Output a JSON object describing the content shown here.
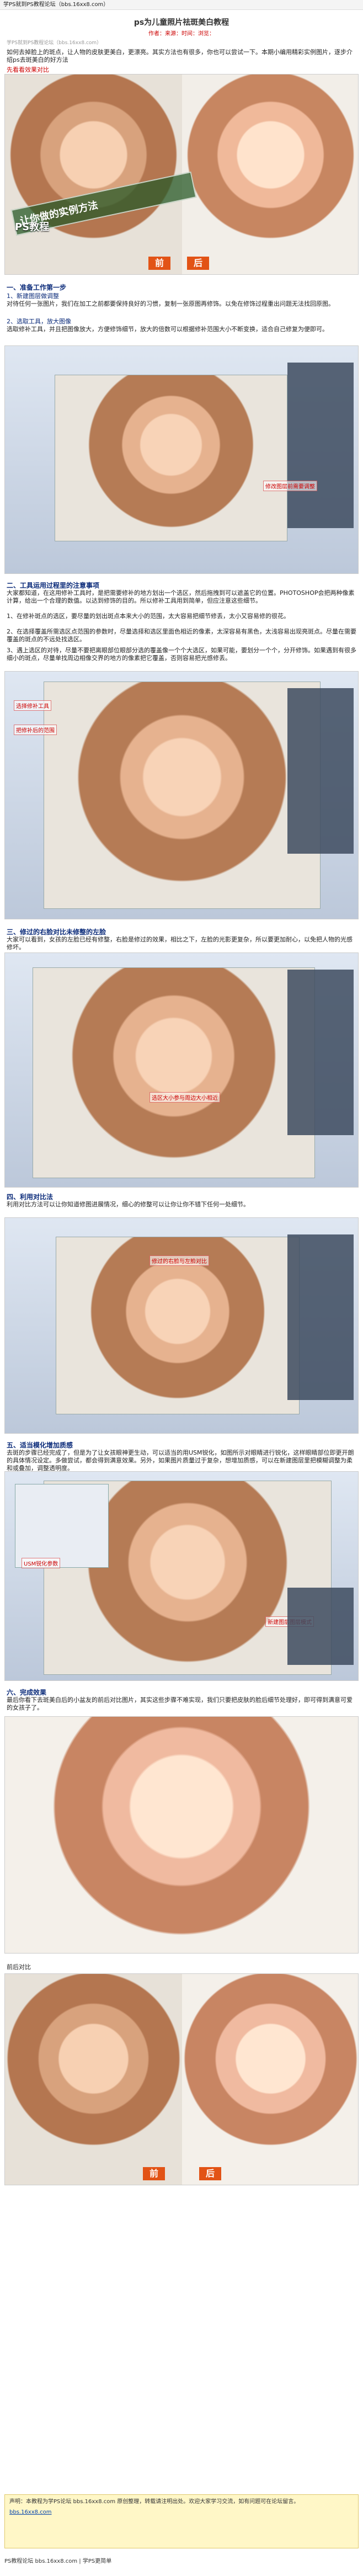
{
  "top_notice": "学PS就到PS教程论坛（bbs.16xx8.com）",
  "title": "ps为儿童照片祛斑美白教程",
  "meta": "作者：来源：时间：浏览：",
  "note": "学PS就到PS教程论坛（bbs.16xx8.com）",
  "intro": "如何去掉脸上的斑点，让人物的皮肤更美白，更漂亮。其实方法也有很多，你也可以尝试一下。本期小编用精彩实例图片，逐步介绍ps去斑美白的好方法",
  "before_after_label": "先看看效果对比",
  "banner_text": "让你做的实例方法",
  "banner_sub": "PS教程",
  "before_label": "前",
  "after_label": "后",
  "sec1_title": "一、准备工作第一步",
  "sec1_l1": "1、新建图层做调整",
  "sec1_l2": "对待任何一张图片，我们在加工之前都要保持良好的习惯，复制一张原图再修饰。以免在修饰过程重出问题无法找回原图。",
  "sec1_l3": "2、选取工具，放大图像",
  "sec1_l4": "选取修补工具，并且把图像放大，方便修饰细节，放大的倍数可以根据修补范围大小不断变换，适合自己修复为便即可。",
  "sec2_title": "二、工具运用过程里的注意事项",
  "sec2_p": "大家都知道，在这用修补工具时，是把需要修补的地方划出一个选区，然后拖拽到可以遮盖它的位置。PHOTOSHOP会把两种像素计算，给出一个合理的数值。以达到修饰的目的。所以修补工具用到简单，但应注意这些细节。",
  "sec2_l1": "1、在修补斑点的选区，要尽量的划出斑点本来大小的范围，太大容易把细节修丢，太小又容易修的很花。",
  "sec2_l2": "2、在选择覆盖所需选区点范围的参数时，尽量选择和选区里面色相近的像素，太深容易有黑色，太浅容易出现亮斑点。尽量在需要覆盖的斑点的不远处找选区。",
  "sec2_l3": "3、遇上选区的对待，尽量不要把离眼部位眼部分选的覆盖像一个个大选区，如果可能，要划分一个个，分开修饰。如果遇到有很多细小的斑点，尽量单找周边相像交界的地方的像素把它覆盖，否则容易把光感修丢。",
  "sec3_title": "三、修过的右脸对比未修整的左脸",
  "sec3_p": "大家可以看到，女孩的左脸已经有修整，右脸是修过的效果，相比之下，左脸的光影更复杂，所以要更加耐心，以免把人物的光感修坏。",
  "sec4_title": "四、利用对比法",
  "sec4_p": "利用对比方法可以让你知道修图进展情况，细心的修整可以让你让你不错下任何一处细节。",
  "sec5_title": "五、适当模化增加质感",
  "sec5_p": "去斑的步骤已经完成了，但是为了让女孩眼神更生动，可以适当的用USM锐化，如图所示对眼睛进行锐化，这样眼睛部位即更开朗的具体情况设定。多做尝试，都会得到满意效果。另外，如果图片质量过于复杂，想增加质感，可以在新建图层里把模糊调整为柔和或叠加，调整透明度。",
  "sec6_title": "六、完成效果",
  "sec6_p": "最后你看下去斑美白后的小盆友的前后对比图片，其实这些步骤不难实现，我们只要把皮肤的脸后细节处理好，即可得到满意可爱的女孩子了。",
  "before_after_final": "前后对比",
  "sec1_img_label": "修改图层前需要调整",
  "sec2_img_label_1": "选择修补工具",
  "sec2_img_label_2": "把修补后的范围",
  "sec3_img_label": "选区大小参与周边大小相近",
  "sec4_img_label": "修过的右脸与左脸对比",
  "sec5_img_label_1": "USM锐化参数",
  "sec5_img_label_2": "新建图层图层模式",
  "footer_text": "声明：本教程为学PS论坛 bbs.16xx8.com 原创整理，转载请注明出处。欢迎大家学习交流，如有问题可在论坛留言。",
  "footer_link": "bbs.16xx8.com",
  "bottom_line": "PS教程论坛 bbs.16xx8.com  |  学PS更简单"
}
